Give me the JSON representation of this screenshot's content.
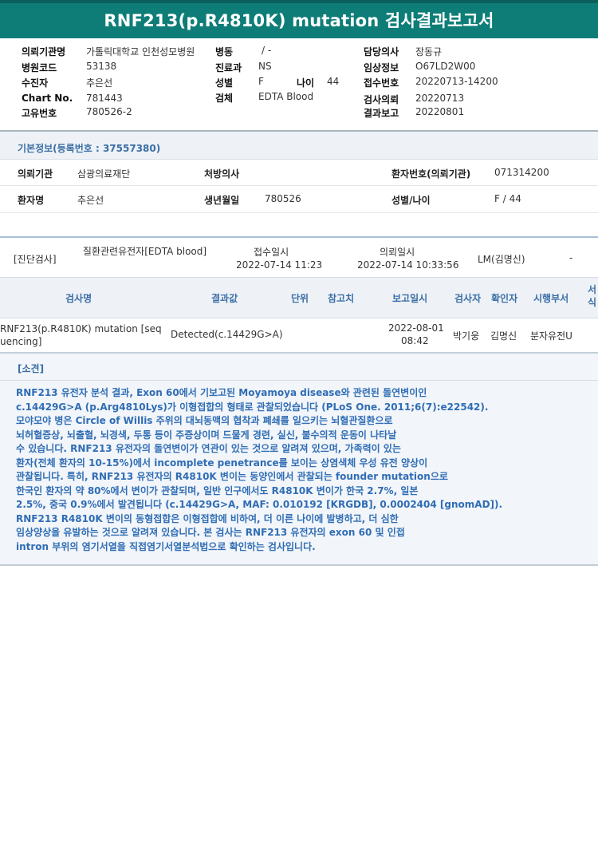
{
  "report": {
    "title": "RNF213(p.R4810K) mutation 검사결과보고서"
  },
  "header": {
    "requesting_institution": {
      "label": "의뢰기관명",
      "value": "가톨릭대학교 인천성모병원"
    },
    "hospital_code": {
      "label": "병원코드",
      "value": "53138"
    },
    "recipient": {
      "label": "수진자",
      "value": "추은선"
    },
    "chart_no": {
      "label": "Chart No.",
      "value": "781443"
    },
    "unique_no": {
      "label": "고유번호",
      "value": "780526-2"
    },
    "ward": {
      "label": "병동",
      "value": "/ -"
    },
    "department": {
      "label": "진료과",
      "value": "NS"
    },
    "sex": {
      "label": "성별",
      "value": "F"
    },
    "age": {
      "label": "나이",
      "value": "44"
    },
    "specimen": {
      "label": "검체",
      "value": "EDTA Blood"
    },
    "physician": {
      "label": "담당의사",
      "value": "장동규"
    },
    "clinical_info": {
      "label": "임상정보",
      "value": "O67LD2W00"
    },
    "receipt_no": {
      "label": "접수번호",
      "value": "20220713-14200"
    },
    "request_date": {
      "label": "검사의뢰",
      "value": "20220713"
    },
    "report_date": {
      "label": "결과보고",
      "value": "20220801"
    }
  },
  "basic_info": {
    "section_title": "기본정보(등록번호 : 37557380)",
    "institution_label": "의뢰기관",
    "institution_value": "삼광의료재단",
    "prescriber_label": "처방의사",
    "patient_no_label": "환자번호(의뢰기관)",
    "patient_no_value": "071314200",
    "patient_name_label": "환자명",
    "patient_name_value": "추은선",
    "birth_label": "생년월일",
    "birth_value": "780526",
    "sex_age_label": "성별/나이",
    "sex_age_value": "F / 44"
  },
  "diagnostic": {
    "category": "[진단검사]",
    "test_group": "질환관련유전자[EDTA blood]",
    "receipt_label": "접수일시",
    "receipt_value": "2022-07-14  11:23",
    "request_label": "의뢰일시",
    "request_value": "2022-07-14  10:33:56",
    "lab": "LM(김명신)",
    "dash": "-"
  },
  "results_table": {
    "columns": [
      "검사명",
      "결과값",
      "단위",
      "참고치",
      "보고일시",
      "검사자",
      "확인자",
      "시행부서",
      "서식"
    ],
    "row": {
      "test_name": "RNF213(p.R4810K) mutation [sequencing]",
      "result": "Detected(c.14429G>A)",
      "unit": "",
      "reference": "",
      "report_date": "2022-08-01",
      "report_time": "08:42",
      "tester": "박기웅",
      "confirmer": "김명신",
      "department": "분자유전U"
    }
  },
  "findings": {
    "title": "[소견]",
    "lines": [
      "RNF213 유전자 분석 결과, Exon 60에서 기보고된 Moyamoya disease와 관련된 돌연변이인",
      "c.14429G>A (p.Arg4810Lys)가 이형접합의 형태로 관찰되었습니다 (PLoS One. 2011;6(7):e22542).",
      "모야모야 병은 Circle of Willis 주위의 대뇌동맥의 협착과 폐쇄를 일으키는 뇌혈관질환으로",
      "뇌허혈증상, 뇌출혈, 뇌경색, 두통 등이 주증상이며 드물게 경련, 실신, 불수의적 운동이 나타날",
      "수 있습니다. RNF213 유전자의 돌연변이가 연관이 있는 것으로 알려져 있으며, 가족력이 있는",
      "환자(전체 환자의 10-15%)에서 incomplete penetrance를 보이는 상염색체 우성 유전 양상이",
      "관찰됩니다. 특히, RNF213 유전자의 R4810K 변이는 동양인에서 관찰되는 founder mutation으로",
      "한국인 환자의 약 80%에서 변이가 관찰되며, 일반 인구에서도 R4810K 변이가 한국 2.7%, 일본",
      "2.5%, 중국 0.9%에서 발견됩니다 (c.14429G>A, MAF: 0.010192 [KRGDB], 0.0002404 [gnomAD]).",
      "RNF213 R4810K 변이의 동형접합은 이형접합에 비하여, 더 이른 나이에 발병하고, 더 심한",
      "임상양상을 유발하는 것으로 알려져 있습니다. 본 검사는 RNF213 유전자의 exon 60 및 인접",
      "intron 부위의 염기서열을 직접염기서열분석법으로 확인하는 검사입니다."
    ]
  }
}
